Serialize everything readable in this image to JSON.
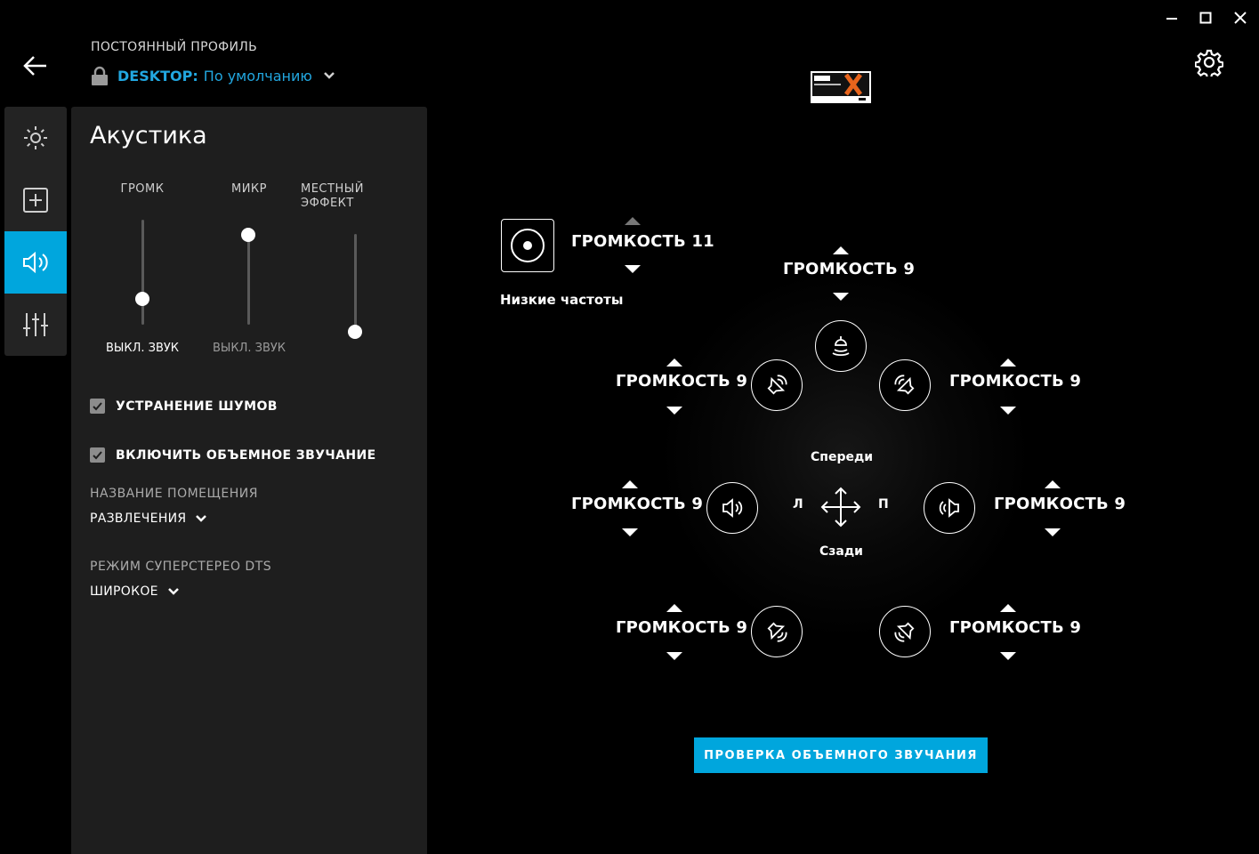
{
  "window": {
    "minimize_icon": "minimize-icon",
    "maximize_icon": "maximize-icon",
    "close_icon": "close-icon"
  },
  "header": {
    "profile_label": "ПОСТОЯННЫЙ ПРОФИЛЬ",
    "profile_device": "DESKTOP:",
    "profile_name": "По умолчанию",
    "accent_color": "#22a7e0"
  },
  "sidebar": {
    "items": [
      {
        "icon": "lighting-icon",
        "active": false
      },
      {
        "icon": "assignments-icon",
        "active": false
      },
      {
        "icon": "acoustics-icon",
        "active": true
      },
      {
        "icon": "equalizer-icon",
        "active": false
      }
    ],
    "active_color": "#00a6dd"
  },
  "panel": {
    "title": "Акустика",
    "sliders": [
      {
        "label": "ГРОМК",
        "mute_label": "ВЫКЛ. ЗВУК",
        "level": 0.25
      },
      {
        "label": "МИКР",
        "mute_label": "ВЫКЛ. ЗВУК",
        "level": 1.0
      },
      {
        "label_line1": "МЕСТНЫЙ",
        "label_line2": "ЭФФЕКТ",
        "level": 0.0
      }
    ],
    "noise_cancel": {
      "label": "УСТРАНЕНИЕ ШУМОВ",
      "checked": true
    },
    "surround": {
      "label": "ВКЛЮЧИТЬ ОБЪЕМНОЕ ЗВУЧАНИЕ",
      "checked": true
    },
    "room": {
      "label": "НАЗВАНИЕ ПОМЕЩЕНИЯ",
      "value": "РАЗВЛЕЧЕНИЯ"
    },
    "stereo": {
      "label": "РЕЖИМ СУПЕРСТЕРЕО DTS",
      "value": "ШИРОКОЕ"
    }
  },
  "surround_view": {
    "logo": "dts-headphone-x-logo",
    "subwoofer": {
      "volume": "ГРОМКОСТЬ 11",
      "label": "Низкие частоты"
    },
    "front_label": "Спереди",
    "rear_label": "Сзади",
    "left_label": "Л",
    "right_label": "П",
    "speakers": {
      "center": "ГРОМКОСТЬ 9",
      "front_left": "ГРОМКОСТЬ 9",
      "front_right": "ГРОМКОСТЬ 9",
      "side_left": "ГРОМКОСТЬ 9",
      "side_right": "ГРОМКОСТЬ 9",
      "rear_left": "ГРОМКОСТЬ 9",
      "rear_right": "ГРОМКОСТЬ 9"
    },
    "test_button": "ПРОВЕРКА ОБЪЕМНОГО ЗВУЧАНИЯ"
  }
}
